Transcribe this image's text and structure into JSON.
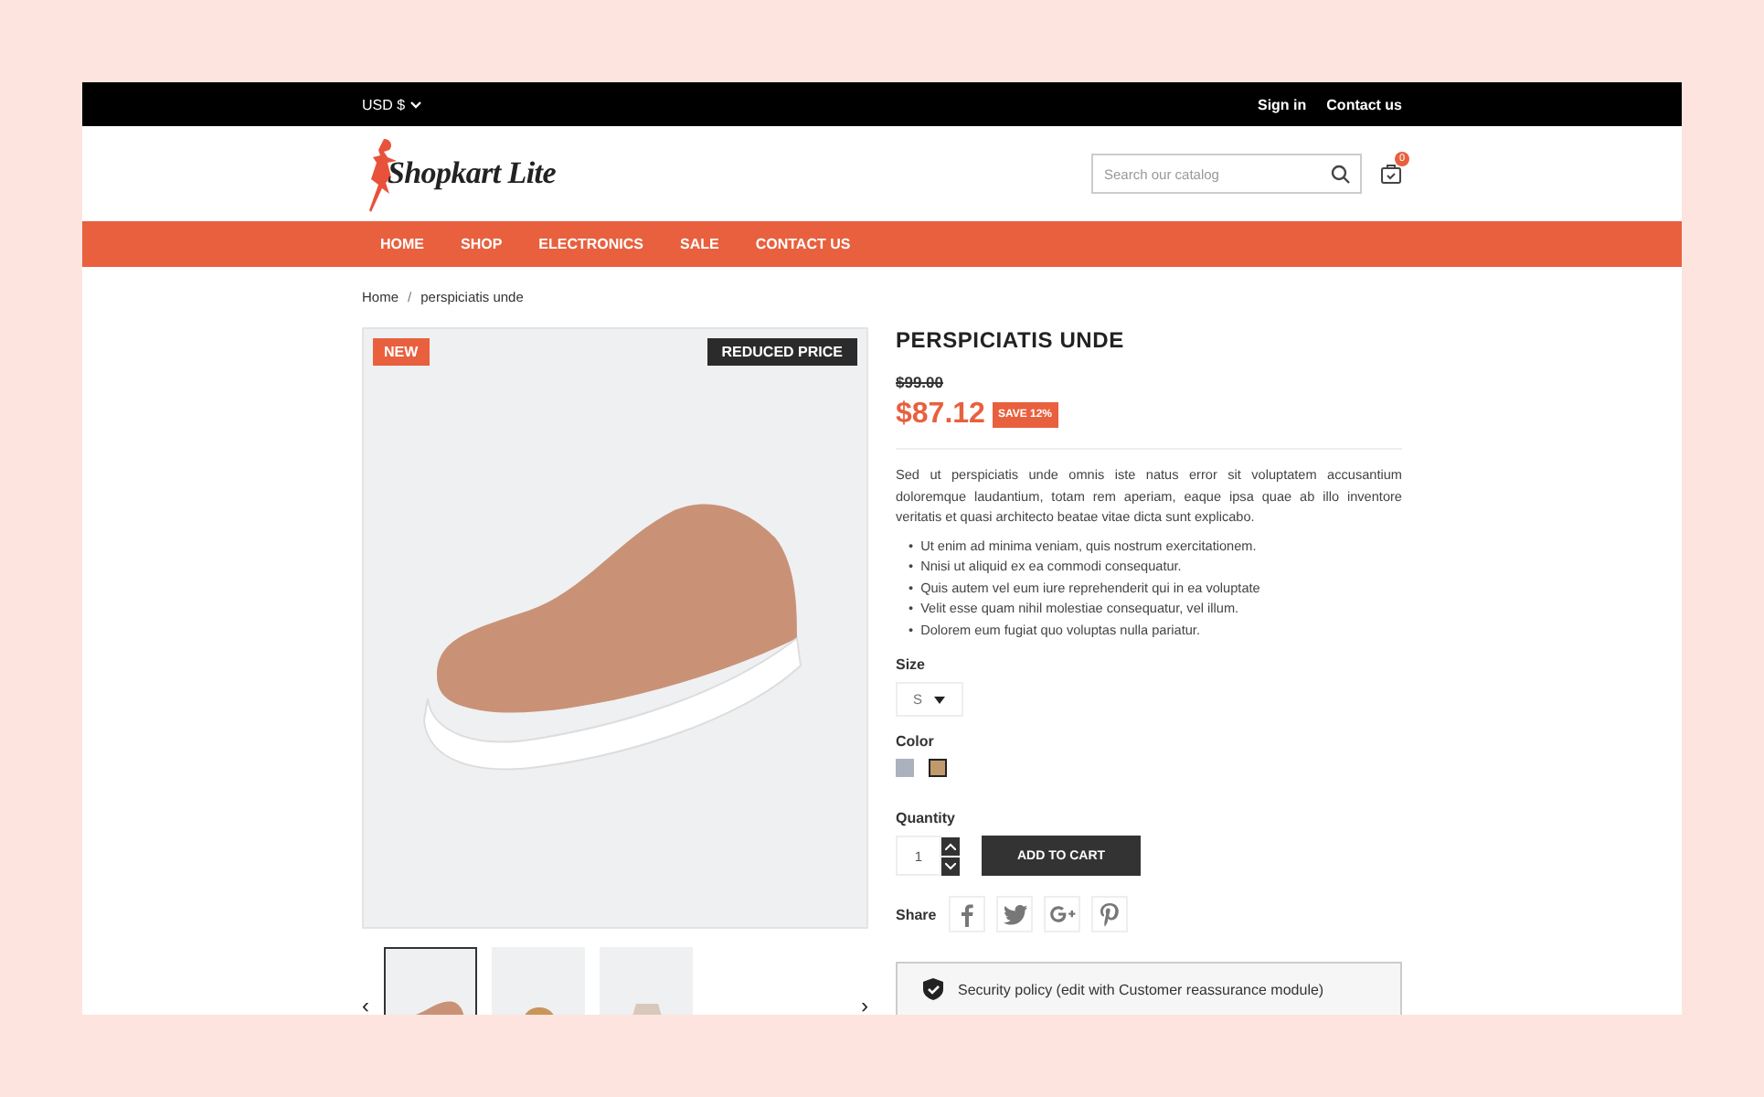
{
  "top_bar": {
    "currency": "USD $",
    "links": [
      "Sign in",
      "Contact us"
    ]
  },
  "header": {
    "logo_text": "Shopkart Lite",
    "search": {
      "placeholder": "Search our catalog"
    },
    "cart_count": "0"
  },
  "nav": [
    "HOME",
    "SHOP",
    "ELECTRONICS",
    "SALE",
    "CONTACT US"
  ],
  "breadcrumb": {
    "separator": "/",
    "items": [
      "Home",
      "perspiciatis unde"
    ]
  },
  "gallery": {
    "badges": [
      {
        "text": "NEW",
        "kind": "new"
      },
      {
        "text": "REDUCED PRICE",
        "kind": "reduced"
      }
    ],
    "prev": "‹",
    "next": "›",
    "thumbnails": [
      {
        "kind": "shoe",
        "selected": true
      },
      {
        "kind": "hat",
        "selected": false
      },
      {
        "kind": "coat",
        "selected": false
      }
    ]
  },
  "product": {
    "title": "PERSPICIATIS UNDE",
    "old_price": "$99.00",
    "price": "$87.12",
    "discount": "SAVE 12%",
    "description": "Sed ut perspiciatis unde omnis iste natus error sit voluptatem accusantium doloremque laudantium, totam rem aperiam, eaque ipsa quae ab illo inventore veritatis et quasi architecto beatae vitae dicta sunt explicabo.",
    "bullet_marker": "•",
    "bullets": [
      "Ut enim ad minima veniam, quis nostrum exercitationem.",
      "Nnisi ut aliquid ex ea commodi consequatur.",
      "Quis autem vel eum iure reprehenderit qui in ea voluptate",
      "Velit esse quam nihil molestiae consequatur, vel illum.",
      "Dolorem eum fugiat quo voluptas nulla pariatur."
    ],
    "size": {
      "label": "Size",
      "value": "S"
    },
    "color": {
      "label": "Color",
      "swatches": [
        {
          "color": "#aab2bd",
          "selected": false
        },
        {
          "color": "#c19a6b",
          "selected": true
        }
      ]
    },
    "quantity": {
      "label": "Quantity",
      "value": "1"
    },
    "add_to_cart": "ADD TO CART",
    "share": {
      "label": "Share",
      "buttons": [
        {
          "kind": "facebook"
        },
        {
          "kind": "twitter"
        },
        {
          "kind": "googleplus"
        },
        {
          "kind": "pinterest"
        }
      ]
    },
    "reassurance": "Security policy (edit with Customer reassurance module)"
  }
}
